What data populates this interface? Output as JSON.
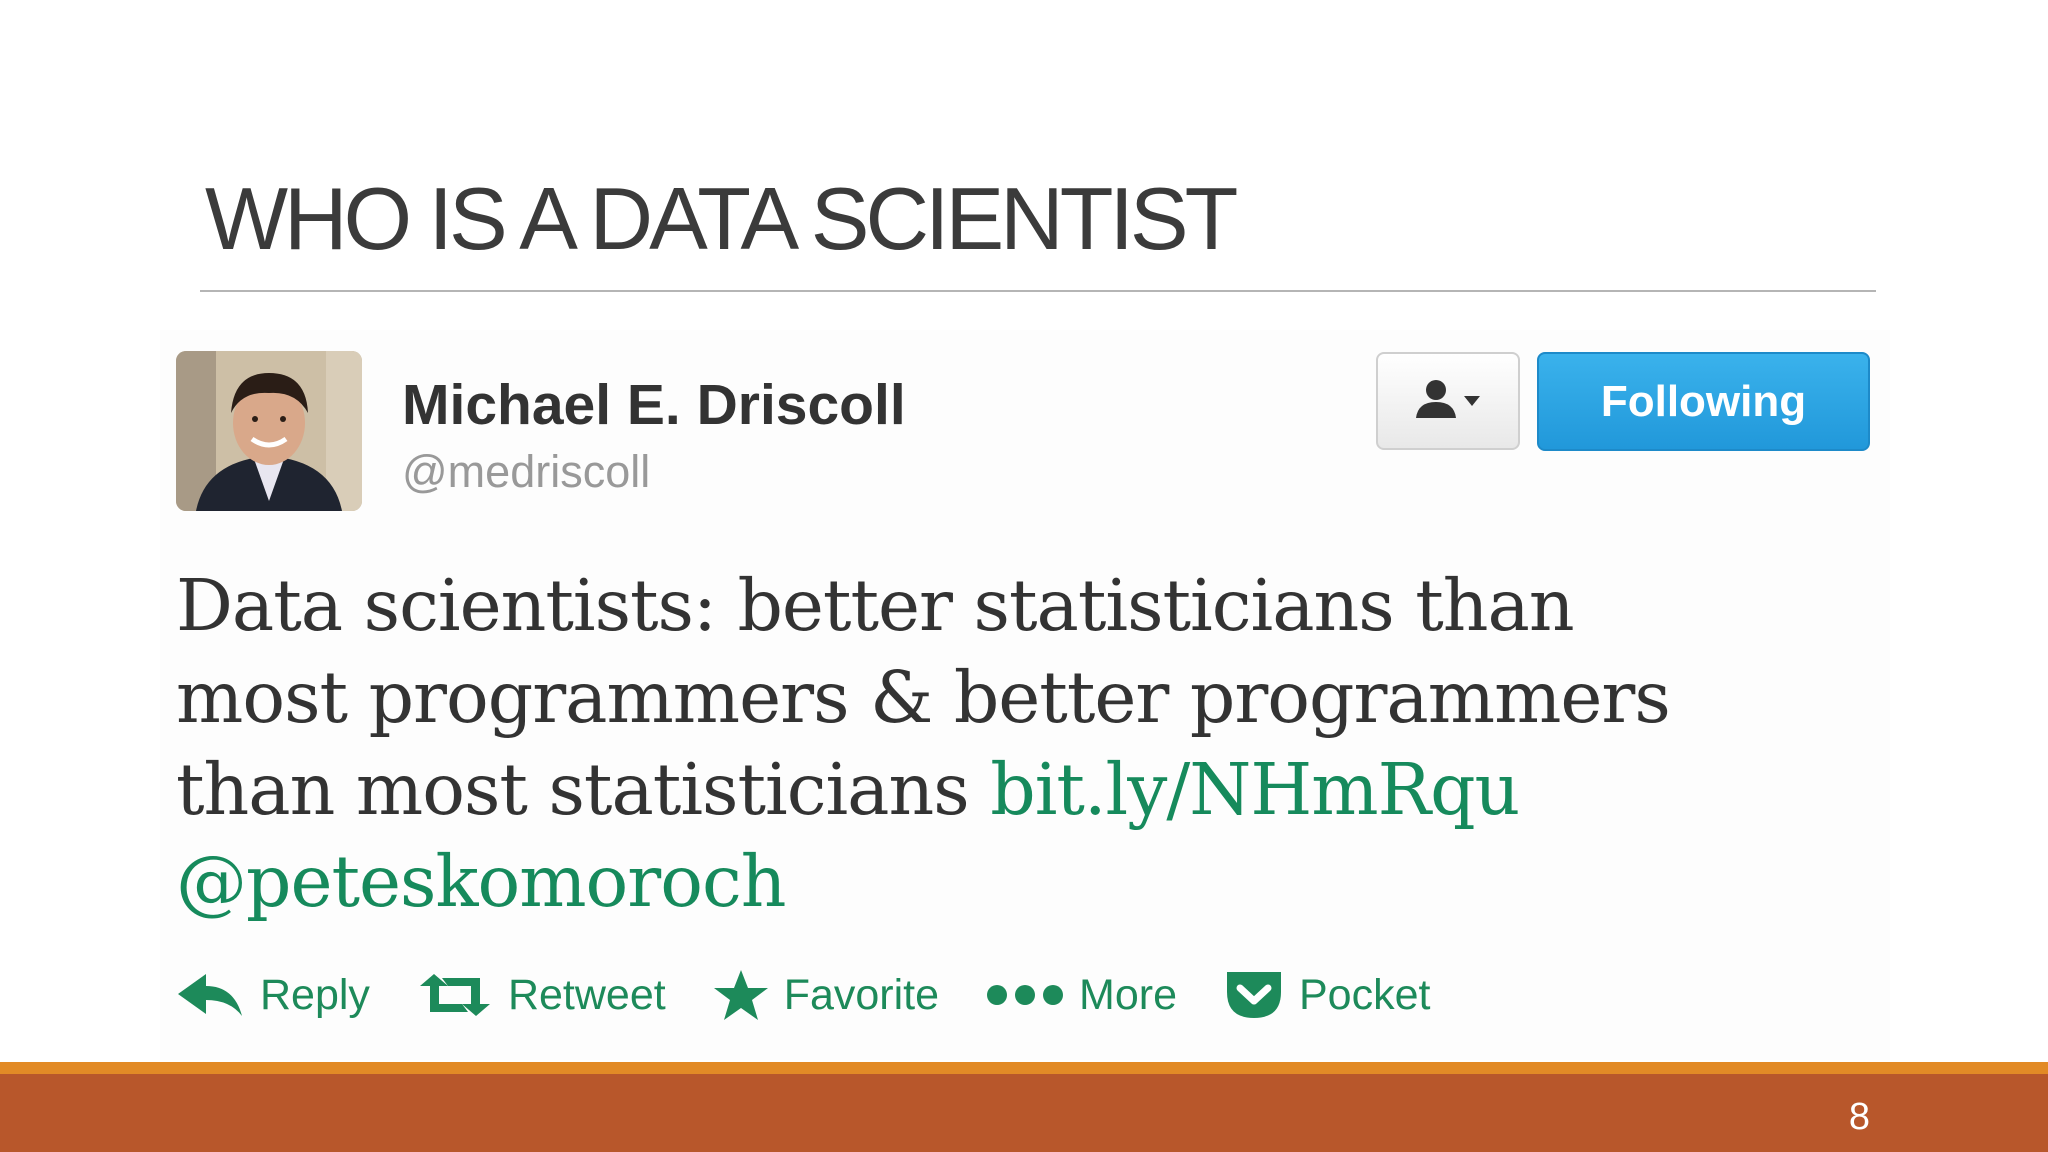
{
  "slide": {
    "title": "WHO IS A DATA SCIENTIST",
    "page_number": "8"
  },
  "tweet": {
    "author_name": "Michael E. Driscoll",
    "author_handle": "@medriscoll",
    "follow_button_label": "Following",
    "text_lines": [
      "Data scientists: better statisticians than",
      "most programmers & better programmers",
      "than most statisticians"
    ],
    "link": "bit.ly/NHmRqu",
    "mention": "@peteskomoroch",
    "actions": {
      "reply": "Reply",
      "retweet": "Retweet",
      "favorite": "Favorite",
      "more": "More",
      "pocket": "Pocket"
    },
    "icons": {
      "avatar": "profile-photo",
      "user_menu": "user-dropdown-icon",
      "reply": "reply-arrow-icon",
      "retweet": "retweet-icon",
      "favorite": "star-icon",
      "more": "three-dots-icon",
      "pocket": "pocket-icon"
    }
  },
  "colors": {
    "title": "#3b3b3b",
    "follow_button": "#2aa3e2",
    "link_green": "#168a5c",
    "footer_bar": "#b8572b",
    "footer_stripe": "#e28a26"
  }
}
